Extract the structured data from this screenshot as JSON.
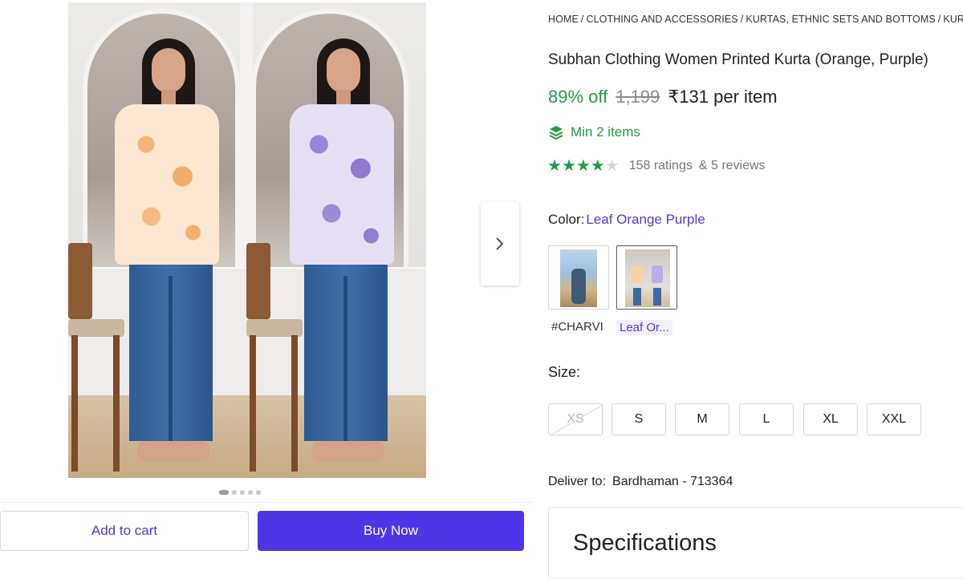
{
  "breadcrumb": [
    "HOME",
    "CLOTHING AND ACCESSORIES",
    "KURTAS, ETHNIC SETS AND BOTTOMS",
    "KURTA"
  ],
  "product": {
    "title": "Subhan Clothing Women Printed Kurta (Orange, Purple)",
    "discount": "89% off",
    "mrp": "1,199",
    "price": "₹131 per item",
    "min_items": "Min 2 items",
    "rating_stars": 4,
    "ratings_text": "158 ratings",
    "reviews_text": "& 5 reviews"
  },
  "color": {
    "label": "Color:",
    "selected": "Leaf Orange Purple",
    "options": [
      "#CHARVI",
      "Leaf Or..."
    ]
  },
  "size": {
    "label": "Size:",
    "options": [
      "XS",
      "S",
      "M",
      "L",
      "XL",
      "XXL"
    ],
    "unavailable": [
      "XS"
    ]
  },
  "delivery": {
    "label": "Deliver to:",
    "location": "Bardhaman - 713364"
  },
  "specifications": {
    "title": "Specifications"
  },
  "actions": {
    "add_to_cart": "Add to cart",
    "buy_now": "Buy Now"
  },
  "gallery": {
    "slide_count": 5,
    "active_slide": 1
  },
  "colors": {
    "accent": "#4e36e6",
    "success": "#239c3e",
    "link": "#4e3ccc"
  },
  "icons": {
    "next": "chevron-right-icon",
    "min_items": "layers-icon",
    "rating": "star-icon"
  }
}
